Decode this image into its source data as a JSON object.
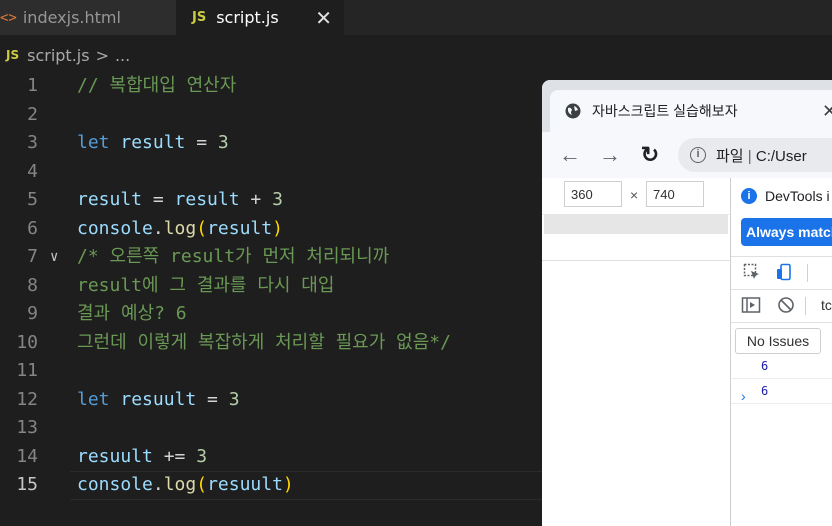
{
  "editor": {
    "tabs": [
      {
        "icon": "<>",
        "label": "indexjs.html"
      },
      {
        "icon": "JS",
        "label": "script.js",
        "close": "✕"
      }
    ],
    "breadcrumb": {
      "icon": "JS",
      "file": "script.js",
      "sep": ">",
      "more": "..."
    },
    "lines": [
      {
        "n": "1",
        "fold": "",
        "tokens": [
          {
            "t": "// 복합대입 연산자",
            "c": "c-comment"
          }
        ]
      },
      {
        "n": "2",
        "fold": "",
        "tokens": []
      },
      {
        "n": "3",
        "fold": "",
        "tokens": [
          {
            "t": "let",
            "c": "c-kw"
          },
          {
            "t": " ",
            "c": "c-op"
          },
          {
            "t": "result",
            "c": "c-var"
          },
          {
            "t": " = ",
            "c": "c-op"
          },
          {
            "t": "3",
            "c": "c-num"
          }
        ]
      },
      {
        "n": "4",
        "fold": "",
        "tokens": []
      },
      {
        "n": "5",
        "fold": "",
        "tokens": [
          {
            "t": "result",
            "c": "c-var"
          },
          {
            "t": " = ",
            "c": "c-op"
          },
          {
            "t": "result",
            "c": "c-var"
          },
          {
            "t": " + ",
            "c": "c-op"
          },
          {
            "t": "3",
            "c": "c-num"
          }
        ]
      },
      {
        "n": "6",
        "fold": "",
        "tokens": [
          {
            "t": "console",
            "c": "c-var"
          },
          {
            "t": ".",
            "c": "c-op"
          },
          {
            "t": "log",
            "c": "c-fn"
          },
          {
            "t": "(",
            "c": "c-paren"
          },
          {
            "t": "result",
            "c": "c-var"
          },
          {
            "t": ")",
            "c": "c-paren"
          }
        ]
      },
      {
        "n": "7",
        "fold": "∨",
        "tokens": [
          {
            "t": "/* 오른쪽 result가 먼저 처리되니까",
            "c": "c-comment"
          }
        ]
      },
      {
        "n": "8",
        "fold": "",
        "tokens": [
          {
            "t": "result에 그 결과를 다시 대입",
            "c": "c-comment"
          }
        ]
      },
      {
        "n": "9",
        "fold": "",
        "tokens": [
          {
            "t": "결과 예상? 6",
            "c": "c-comment"
          }
        ]
      },
      {
        "n": "10",
        "fold": "",
        "tokens": [
          {
            "t": "그런데 이렇게 복잡하게 처리할 필요가 없음*/",
            "c": "c-comment"
          }
        ]
      },
      {
        "n": "11",
        "fold": "",
        "tokens": []
      },
      {
        "n": "12",
        "fold": "",
        "tokens": [
          {
            "t": "let",
            "c": "c-kw"
          },
          {
            "t": " ",
            "c": "c-op"
          },
          {
            "t": "resuult",
            "c": "c-var"
          },
          {
            "t": " = ",
            "c": "c-op"
          },
          {
            "t": "3",
            "c": "c-num"
          }
        ]
      },
      {
        "n": "13",
        "fold": "",
        "tokens": []
      },
      {
        "n": "14",
        "fold": "",
        "tokens": [
          {
            "t": "resuult",
            "c": "c-var"
          },
          {
            "t": " += ",
            "c": "c-op"
          },
          {
            "t": "3",
            "c": "c-num"
          }
        ]
      },
      {
        "n": "15",
        "fold": "",
        "current": true,
        "tokens": [
          {
            "t": "console",
            "c": "c-var"
          },
          {
            "t": ".",
            "c": "c-op"
          },
          {
            "t": "log",
            "c": "c-fn"
          },
          {
            "t": "(",
            "c": "c-paren"
          },
          {
            "t": "resuult",
            "c": "c-var"
          },
          {
            "t": ")",
            "c": "c-paren"
          }
        ]
      }
    ]
  },
  "browser": {
    "tab_title": "자바스크립트 실습해보자",
    "tab_close": "✕",
    "omnibox": {
      "info": "i",
      "prefix": "파일",
      "sep": "|",
      "url": "C:/User"
    },
    "device": {
      "width": "360",
      "x": "×",
      "height": "740"
    },
    "devtools": {
      "banner": "DevTools i",
      "info": "i",
      "button": "Always match",
      "console_label": "tc",
      "issues": "No Issues",
      "logs": [
        "6",
        "6"
      ],
      "prompt": "›"
    }
  }
}
